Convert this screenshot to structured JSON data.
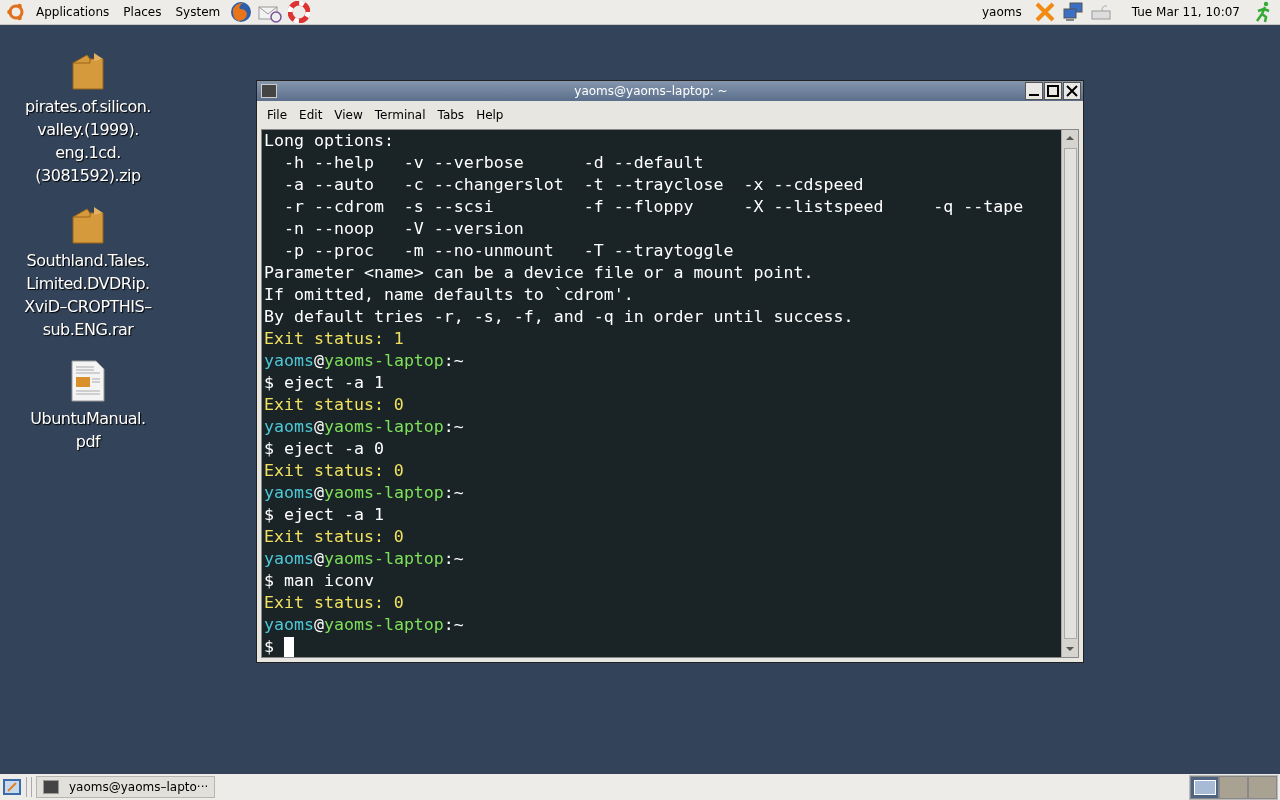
{
  "top_panel": {
    "menus": [
      "Applications",
      "Places",
      "System"
    ],
    "user": "yaoms",
    "clock": "Tue Mar 11, 10:07"
  },
  "desktop_icons": [
    {
      "kind": "archive",
      "label": "pirates.of.silicon.\nvalley.(1999).\neng.1cd.\n(3081592).zip"
    },
    {
      "kind": "archive",
      "label": "Southland.Tales.\nLimited.DVDRip.\nXviD–CROPTHIS–\nsub.ENG.rar"
    },
    {
      "kind": "document",
      "label": "UbuntuManual.\npdf"
    }
  ],
  "window": {
    "title": "yaoms@yaoms–laptop: ~",
    "menu": [
      "File",
      "Edit",
      "View",
      "Terminal",
      "Tabs",
      "Help"
    ],
    "lines": [
      {
        "kind": "text",
        "text": "Long options:"
      },
      {
        "kind": "text",
        "text": "  -h --help   -v --verbose      -d --default"
      },
      {
        "kind": "text",
        "text": "  -a --auto   -c --changerslot  -t --trayclose  -x --cdspeed"
      },
      {
        "kind": "text",
        "text": "  -r --cdrom  -s --scsi         -f --floppy     -X --listspeed     -q --tape"
      },
      {
        "kind": "text",
        "text": "  -n --noop   -V --version"
      },
      {
        "kind": "text",
        "text": "  -p --proc   -m --no-unmount   -T --traytoggle"
      },
      {
        "kind": "text",
        "text": "Parameter <name> can be a device file or a mount point."
      },
      {
        "kind": "text",
        "text": "If omitted, name defaults to `cdrom'."
      },
      {
        "kind": "text",
        "text": "By default tries -r, -s, -f, and -q in order until success."
      },
      {
        "kind": "status",
        "text": "Exit status: 1"
      },
      {
        "kind": "prompt",
        "user": "yaoms",
        "at": "@",
        "host": "yaoms-laptop",
        "path": ":~"
      },
      {
        "kind": "text",
        "text": "$ eject -a 1"
      },
      {
        "kind": "status",
        "text": "Exit status: 0"
      },
      {
        "kind": "prompt",
        "user": "yaoms",
        "at": "@",
        "host": "yaoms-laptop",
        "path": ":~"
      },
      {
        "kind": "text",
        "text": "$ eject -a 0"
      },
      {
        "kind": "status",
        "text": "Exit status: 0"
      },
      {
        "kind": "prompt",
        "user": "yaoms",
        "at": "@",
        "host": "yaoms-laptop",
        "path": ":~"
      },
      {
        "kind": "text",
        "text": "$ eject -a 1"
      },
      {
        "kind": "status",
        "text": "Exit status: 0"
      },
      {
        "kind": "prompt",
        "user": "yaoms",
        "at": "@",
        "host": "yaoms-laptop",
        "path": ":~"
      },
      {
        "kind": "text",
        "text": "$ man iconv"
      },
      {
        "kind": "status",
        "text": "Exit status: 0"
      },
      {
        "kind": "prompt",
        "user": "yaoms",
        "at": "@",
        "host": "yaoms-laptop",
        "path": ":~"
      },
      {
        "kind": "input",
        "text": "$ "
      }
    ]
  },
  "taskbar": {
    "tasks": [
      {
        "label": "yaoms@yaoms–lapto···",
        "selected": false
      }
    ],
    "workspaces": [
      {
        "selected": true
      },
      {
        "selected": false
      },
      {
        "selected": false
      }
    ]
  }
}
